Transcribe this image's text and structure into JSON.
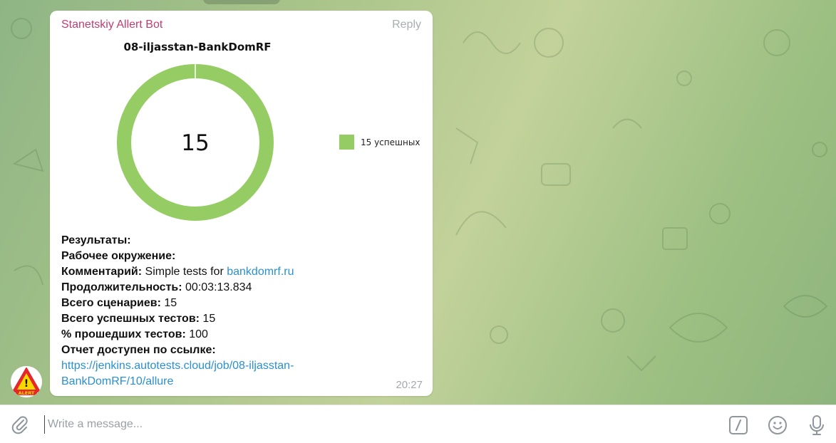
{
  "message": {
    "sender": "Stanetskiy Allert Bot",
    "reply_label": "Reply",
    "time": "20:27",
    "lines": [
      {
        "label": "Результаты:",
        "value": ""
      },
      {
        "label": "Рабочее окружение:",
        "value": ""
      },
      {
        "label": "Комментарий:",
        "value": " Simple tests for ",
        "link": "bankdomrf.ru"
      },
      {
        "label": "Продолжительность:",
        "value": " 00:03:13.834"
      },
      {
        "label": "Всего сценариев:",
        "value": " 15"
      },
      {
        "label": "Всего успешных тестов:",
        "value": " 15"
      },
      {
        "label": "% прошедших тестов:",
        "value": " 100"
      },
      {
        "label": "Отчет доступен по ссылке:",
        "value": ""
      }
    ],
    "report_link_line1": "https://jenkins.autotests.cloud/job/08-iljasstan-",
    "report_link_line2": "BankDomRF/10/allure"
  },
  "chart_data": {
    "type": "pie",
    "title": "08-iljasstan-BankDomRF",
    "center_label": "15",
    "categories": [
      "15 успешных"
    ],
    "values": [
      15
    ],
    "colors": [
      "#95cd64"
    ],
    "legend_position": "right"
  },
  "avatar": {
    "badge_text": "ALERT",
    "symbol": "!"
  },
  "composer": {
    "placeholder": "Write a message..."
  },
  "icons": {
    "attach": "paperclip-icon",
    "commands": "slash-commands-icon",
    "emoji": "smiley-icon",
    "mic": "microphone-icon"
  },
  "colors": {
    "sender": "#c03d71",
    "link": "#2b8fd1",
    "donut": "#95cd64"
  }
}
